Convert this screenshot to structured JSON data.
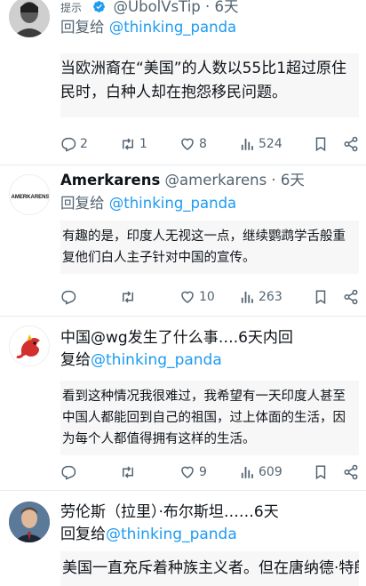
{
  "tweets": [
    {
      "hint": "提示",
      "handle": "@UbolVsTip",
      "time": "· 6天",
      "reply_prefix": "回复给",
      "reply_to": "@thinking_panda",
      "body": "当欧洲裔在“美国”的人数以55比1超过原住民时，白种人却在抱怨移民问题。",
      "replies": "2",
      "retweets": "1",
      "likes": "8",
      "views": "524"
    },
    {
      "name": "Amerkarens",
      "handle": "@amerkarens",
      "time": "· 6天",
      "reply_prefix": "回复给",
      "reply_to": "@thinking_panda",
      "body": "有趣的是，印度人无视这一点，继续鹦鹉学舌般重复他们白人主子针对中国的宣传。",
      "replies": "",
      "retweets": "",
      "likes": "10",
      "views": "263",
      "avatar_text": "AMERKARENS"
    },
    {
      "name_line": "中国@wg发生了什么事….6天内回",
      "reply_prefix": "复给",
      "reply_to": "@thinking_panda",
      "body": "看到这种情况我很难过，我希望有一天印度人甚至中国人都能回到自己的祖国，过上体面的生活，因为每个人都值得拥有这样的生活。",
      "replies": "",
      "retweets": "",
      "likes": "9",
      "views": "609"
    },
    {
      "name_line": "劳伦斯（拉里）·布尔斯坦……6天",
      "reply_prefix": "回复给",
      "reply_to": "@thinking_panda",
      "body": "美国一直充斥着种族主义者。但在唐纳德·特朗"
    }
  ],
  "colors": {
    "accent": "#1d9bf0",
    "muted": "#536471",
    "text": "#0f1419"
  },
  "icons": [
    "reply-icon",
    "retweet-icon",
    "like-icon",
    "views-icon",
    "bookmark-icon",
    "share-icon",
    "verified-icon"
  ]
}
